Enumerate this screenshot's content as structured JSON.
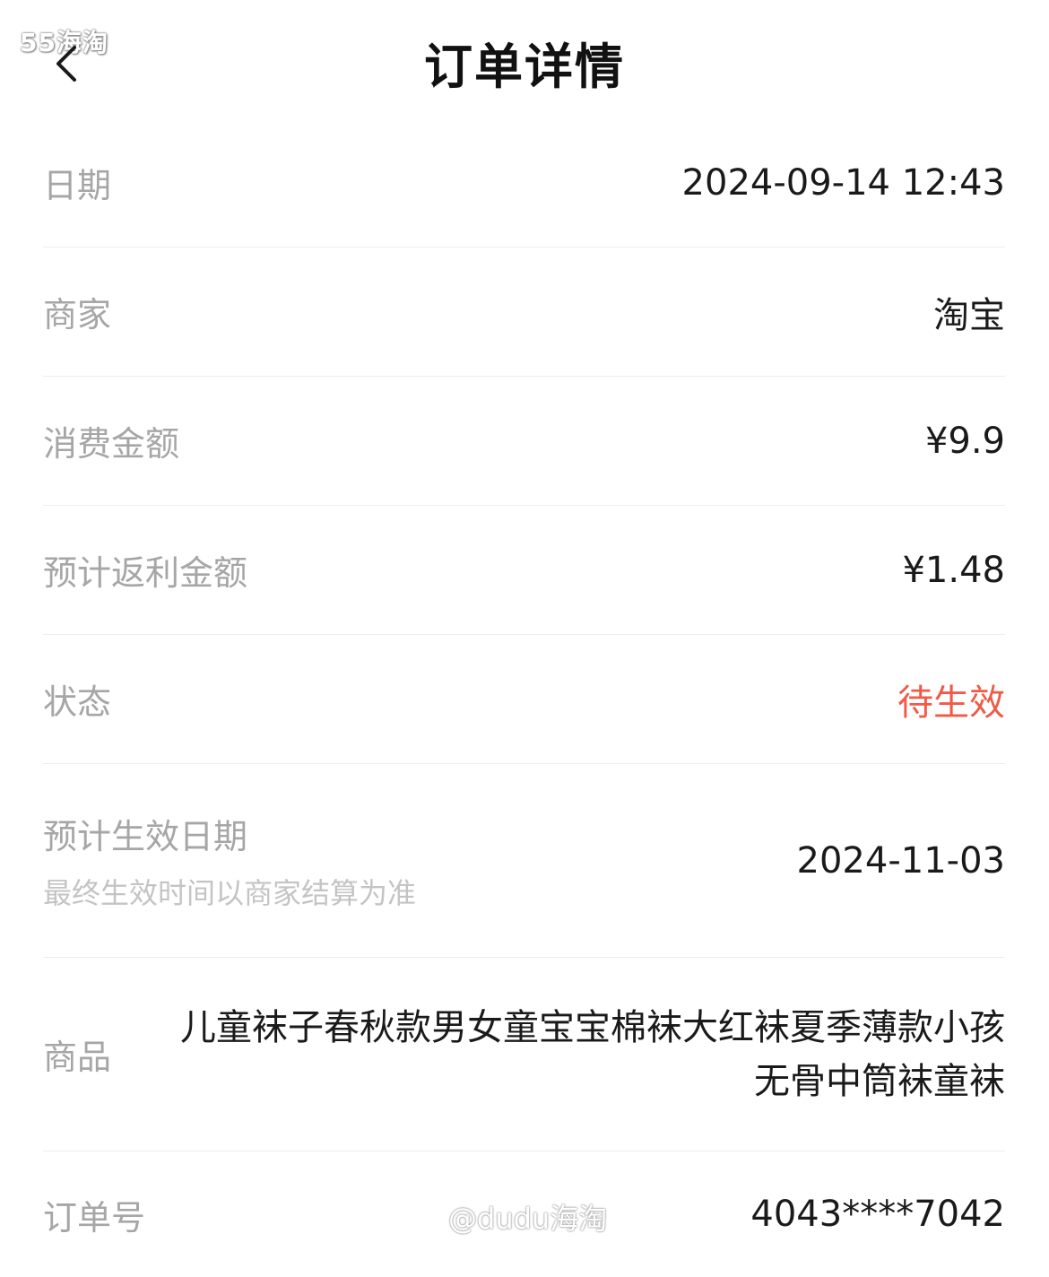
{
  "watermark_top": "55海淘",
  "watermark_center": "@dudu海淘",
  "header": {
    "title": "订单详情"
  },
  "rows": {
    "date": {
      "label": "日期",
      "value": "2024-09-14 12:43"
    },
    "merchant": {
      "label": "商家",
      "value": "淘宝"
    },
    "amount": {
      "label": "消费金额",
      "value": "¥9.9"
    },
    "rebate": {
      "label": "预计返利金额",
      "value": "¥1.48"
    },
    "status": {
      "label": "状态",
      "value": "待生效",
      "color": "#f05a47"
    },
    "effective": {
      "label": "预计生效日期",
      "sublabel": "最终生效时间以商家结算为准",
      "value": "2024-11-03"
    },
    "product": {
      "label": "商品",
      "value": "儿童袜子春秋款男女童宝宝棉袜大红袜夏季薄款小孩无骨中筒袜童袜"
    },
    "order_no": {
      "label": "订单号",
      "value": "4043****7042"
    }
  }
}
